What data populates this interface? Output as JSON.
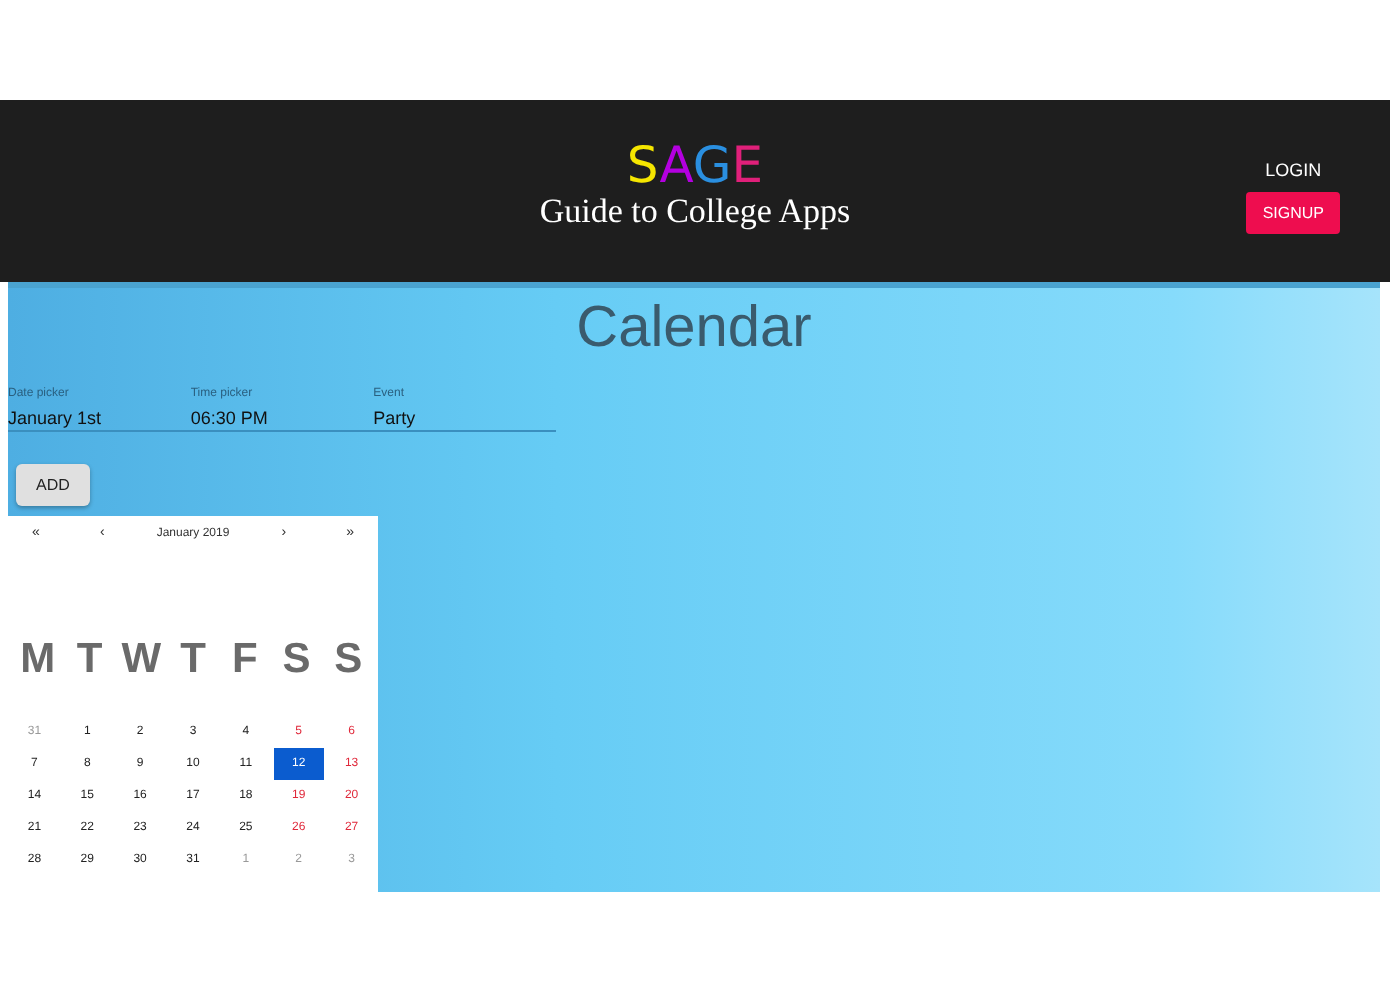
{
  "header": {
    "logo": [
      {
        "letter": "S",
        "color": "#f5e600"
      },
      {
        "letter": "A",
        "color": "#b400e0"
      },
      {
        "letter": "G",
        "color": "#2a8fe0"
      },
      {
        "letter": "E",
        "color": "#e0207a"
      }
    ],
    "subtitle": "Guide to College Apps",
    "login": "LOGIN",
    "signup": "SIGNUP"
  },
  "title": "Calendar",
  "fields": [
    {
      "label": "Date picker",
      "value": "January 1st"
    },
    {
      "label": "Time picker",
      "value": "06:30 PM"
    },
    {
      "label": "Event",
      "value": "Party"
    }
  ],
  "add_button": "ADD",
  "calendar": {
    "prev_year": "«",
    "prev_month": "‹",
    "month": "January 2019",
    "next_month": "›",
    "next_year": "»",
    "weekdays": [
      "M",
      "T",
      "W",
      "T",
      "F",
      "S",
      "S"
    ],
    "weeks": [
      [
        {
          "day": "31",
          "kind": "other",
          "selected": false
        },
        {
          "day": "1",
          "kind": "normal",
          "selected": false
        },
        {
          "day": "2",
          "kind": "normal",
          "selected": false
        },
        {
          "day": "3",
          "kind": "normal",
          "selected": false
        },
        {
          "day": "4",
          "kind": "normal",
          "selected": false
        },
        {
          "day": "5",
          "kind": "weekend",
          "selected": false
        },
        {
          "day": "6",
          "kind": "weekend",
          "selected": false
        }
      ],
      [
        {
          "day": "7",
          "kind": "normal",
          "selected": false
        },
        {
          "day": "8",
          "kind": "normal",
          "selected": false
        },
        {
          "day": "9",
          "kind": "normal",
          "selected": false
        },
        {
          "day": "10",
          "kind": "normal",
          "selected": false
        },
        {
          "day": "11",
          "kind": "normal",
          "selected": false
        },
        {
          "day": "12",
          "kind": "weekend",
          "selected": true
        },
        {
          "day": "13",
          "kind": "weekend",
          "selected": false
        }
      ],
      [
        {
          "day": "14",
          "kind": "normal",
          "selected": false
        },
        {
          "day": "15",
          "kind": "normal",
          "selected": false
        },
        {
          "day": "16",
          "kind": "normal",
          "selected": false
        },
        {
          "day": "17",
          "kind": "normal",
          "selected": false
        },
        {
          "day": "18",
          "kind": "normal",
          "selected": false
        },
        {
          "day": "19",
          "kind": "weekend",
          "selected": false
        },
        {
          "day": "20",
          "kind": "weekend",
          "selected": false
        }
      ],
      [
        {
          "day": "21",
          "kind": "normal",
          "selected": false
        },
        {
          "day": "22",
          "kind": "normal",
          "selected": false
        },
        {
          "day": "23",
          "kind": "normal",
          "selected": false
        },
        {
          "day": "24",
          "kind": "normal",
          "selected": false
        },
        {
          "day": "25",
          "kind": "normal",
          "selected": false
        },
        {
          "day": "26",
          "kind": "weekend",
          "selected": false
        },
        {
          "day": "27",
          "kind": "weekend",
          "selected": false
        }
      ],
      [
        {
          "day": "28",
          "kind": "normal",
          "selected": false
        },
        {
          "day": "29",
          "kind": "normal",
          "selected": false
        },
        {
          "day": "30",
          "kind": "normal",
          "selected": false
        },
        {
          "day": "31",
          "kind": "normal",
          "selected": false
        },
        {
          "day": "1",
          "kind": "other",
          "selected": false
        },
        {
          "day": "2",
          "kind": "other",
          "selected": false
        },
        {
          "day": "3",
          "kind": "other",
          "selected": false
        }
      ]
    ]
  }
}
